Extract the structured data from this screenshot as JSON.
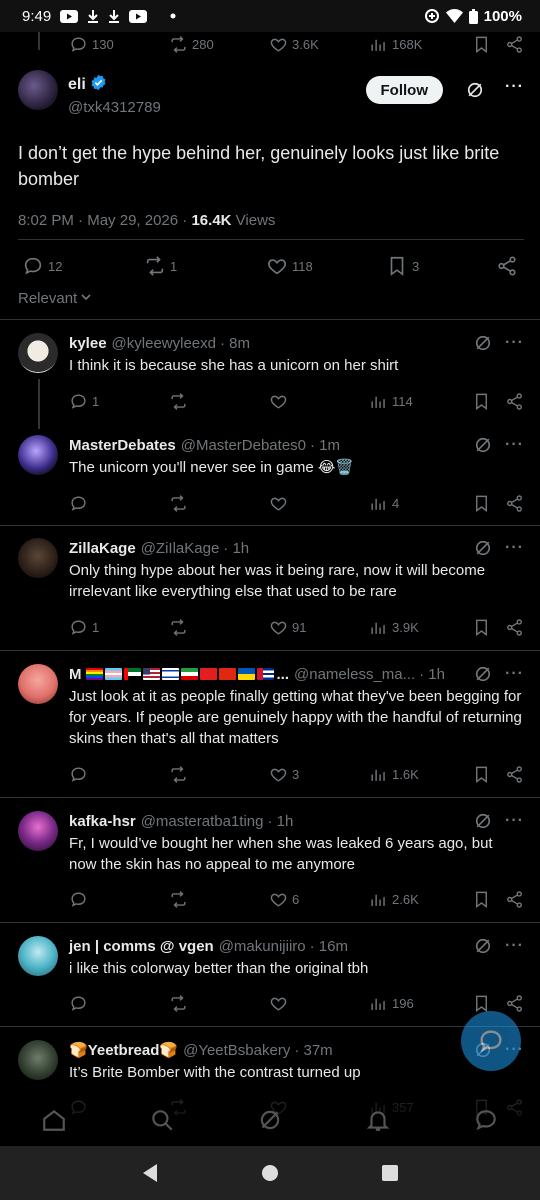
{
  "status_bar": {
    "time": "9:49",
    "battery": "100%"
  },
  "top_actions": {
    "replies": "130",
    "reposts": "280",
    "likes": "3.6K",
    "views": "168K"
  },
  "main_tweet": {
    "name": "eli",
    "handle": "@txk4312789",
    "follow_label": "Follow",
    "text": "I don’t get the hype behind her, genuinely looks just like brite bomber",
    "time": "8:02 PM",
    "date": "May 29, 2026",
    "views_count": "16.4K",
    "views_label": "Views",
    "replies": "12",
    "reposts": "1",
    "likes": "118",
    "bookmarks": "3"
  },
  "sort_label": "Relevant",
  "replies": [
    {
      "name": "kylee",
      "handle": "@kyleewyleexd",
      "time": "8m",
      "text": "I think it is because she has a unicorn on her shirt",
      "replies": "1",
      "reposts": "",
      "likes": "",
      "views": "114"
    },
    {
      "name": "MasterDebates",
      "handle": "@MasterDebates0",
      "time": "1m",
      "text": "The unicorn you'll never see in game 😂🗑️",
      "replies": "",
      "reposts": "",
      "likes": "",
      "views": "4"
    },
    {
      "name": "ZillaKage",
      "handle": "@ZiIlaKage",
      "time": "1h",
      "text": "Only thing hype about her was it being rare, now it will become irrelevant like everything else that used to be rare",
      "replies": "1",
      "reposts": "",
      "likes": "91",
      "views": "3.9K"
    },
    {
      "name": "M",
      "handle": "@nameless_ma...",
      "time": "1h",
      "text": "Just look at it as people finally getting what they've been begging for for years. If people are genuinely happy with the handful of returning skins then that's all that matters",
      "replies": "",
      "reposts": "",
      "likes": "3",
      "views": "1.6K",
      "name_suffix": "..."
    },
    {
      "name": "kafka-hsr",
      "handle": "@masteratba1ting",
      "time": "1h",
      "text": "Fr, I would’ve bought her when she was leaked 6 years ago, but now the skin has no appeal to me anymore",
      "replies": "",
      "reposts": "",
      "likes": "6",
      "views": "2.6K"
    },
    {
      "name": "jen | comms @ vgen",
      "handle": "@makunijiiro",
      "time": "16m",
      "text": "i like this colorway better than the original tbh",
      "replies": "",
      "reposts": "",
      "likes": "",
      "views": "196"
    },
    {
      "name": "Yeetbread",
      "handle": "@YeetBsbakery",
      "time": "37m",
      "text": "It’s Brite Bomber with the contrast turned up",
      "replies": "",
      "reposts": "",
      "likes": "",
      "views": "357"
    }
  ],
  "colors": {
    "accent": "#1d9bf0",
    "muted": "#71767b",
    "text": "#e7e9ea",
    "divider": "#2f3336"
  }
}
